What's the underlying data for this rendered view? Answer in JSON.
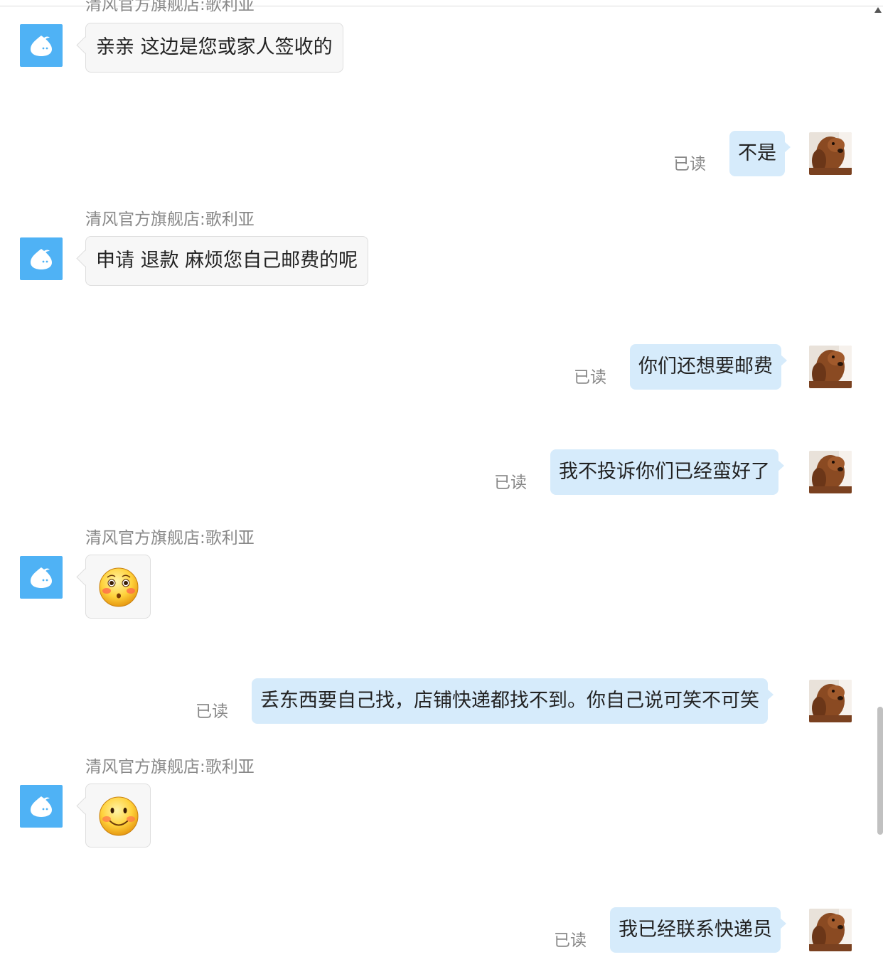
{
  "shop_name": "清风官方旗舰店:歌利亚",
  "read_label": "已读",
  "messages": [
    {
      "text": "亲亲 这边是您或家人签收的"
    },
    {
      "text": "不是"
    },
    {
      "text": "申请 退款  麻烦您自己邮费的呢"
    },
    {
      "text": "你们还想要邮费"
    },
    {
      "text": "我不投诉你们已经蛮好了"
    },
    {
      "emoji": "shy-face-emoji"
    },
    {
      "text": "丢东西要自己找，店铺快递都找不到。你自己说可笑不可笑"
    },
    {
      "emoji": "smile-face-emoji"
    },
    {
      "text": "我已经联系快递员"
    }
  ],
  "colors": {
    "shop_avatar": "#4fb2f5",
    "outgoing_bubble": "#d6ebfb",
    "incoming_bubble": "#f7f7f7",
    "meta_text": "#888888"
  },
  "icons": {
    "shop_avatar": "water-drop-mascot-icon",
    "user_avatar": "dog-photo-avatar"
  }
}
